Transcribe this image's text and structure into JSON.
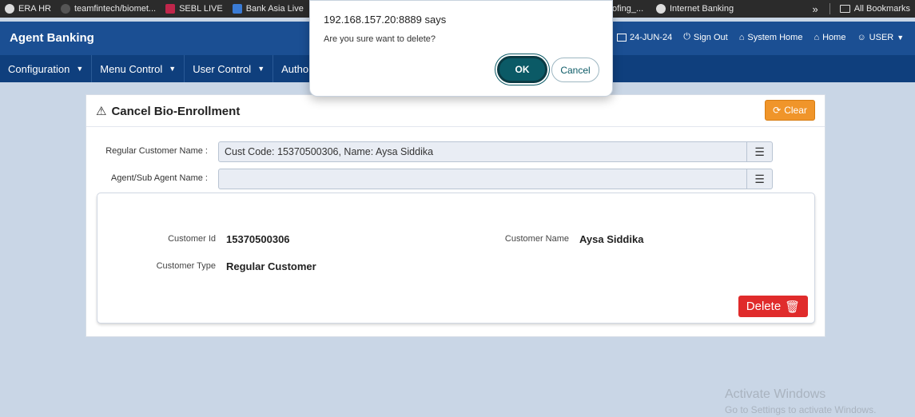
{
  "bookmarks": [
    {
      "label": "ERA HR",
      "icon": "github-icon"
    },
    {
      "label": "teamfintech/biomet...",
      "icon": "github-icon"
    },
    {
      "label": "SEBL LIVE",
      "icon": "sebl-icon"
    },
    {
      "label": "Bank Asia Live",
      "icon": "grid-icon"
    },
    {
      "label": "ofing_...",
      "icon": "page-icon"
    },
    {
      "label": "Internet Banking",
      "icon": "github-icon"
    }
  ],
  "bookmarks_all": "All Bookmarks",
  "header": {
    "brand": "Agent Banking",
    "date": "24-JUN-24",
    "sign_out": "Sign Out",
    "system_home": "System Home",
    "home": "Home",
    "user": "USER"
  },
  "menu": [
    {
      "label": "Configuration"
    },
    {
      "label": "Menu Control"
    },
    {
      "label": "User Control"
    },
    {
      "label": "Autho"
    }
  ],
  "page": {
    "title": "Cancel Bio-Enrollment",
    "clear_label": "Clear",
    "fields": {
      "regular_customer_label": "Regular Customer Name :",
      "regular_customer_value": "Cust Code: 15370500306, Name: Aysa Siddika",
      "agent_label": "Agent/Sub Agent Name :",
      "agent_value": ""
    },
    "info": {
      "customer_id_label": "Customer Id",
      "customer_id_value": "15370500306",
      "customer_name_label": "Customer Name",
      "customer_name_value": "Aysa Siddika",
      "customer_type_label": "Customer Type",
      "customer_type_value": "Regular Customer"
    },
    "delete_label": "Delete"
  },
  "dialog": {
    "title": "192.168.157.20:8889 says",
    "message": "Are you sure want to delete?",
    "ok_label": "OK",
    "cancel_label": "Cancel"
  },
  "watermark": {
    "line1": "Activate Windows",
    "line2": "Go to Settings to activate Windows."
  },
  "colors": {
    "header": "#1b4f93",
    "menubar": "#0f3f7d",
    "clear_button": "#f0952a",
    "delete_button": "#e02b2b",
    "ok_button": "#0b5a66"
  }
}
